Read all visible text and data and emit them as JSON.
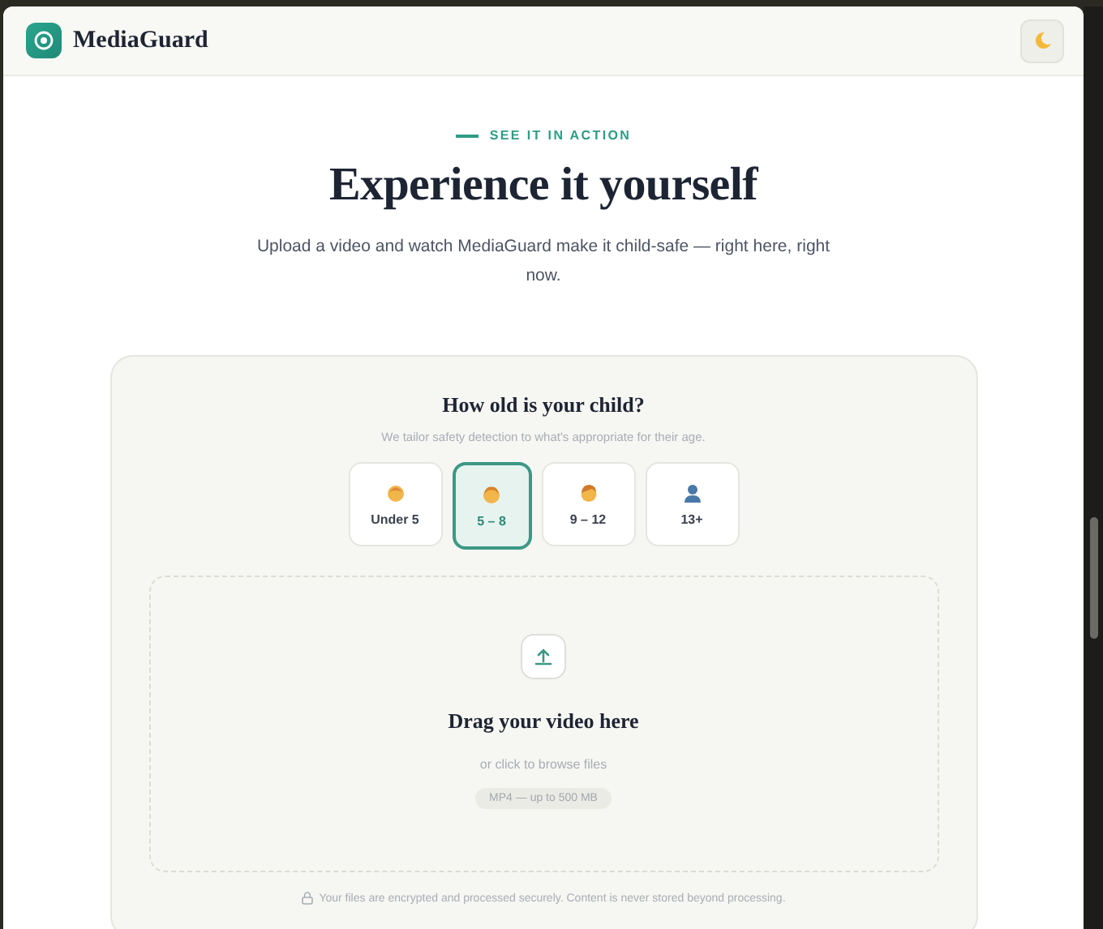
{
  "header": {
    "brand": "MediaGuard"
  },
  "hero": {
    "eyebrow": "SEE IT IN ACTION",
    "title": "Experience it yourself",
    "subtitle": "Upload a video and watch MediaGuard make it child-safe — right here, right now."
  },
  "age_picker": {
    "title": "How old is your child?",
    "subtitle": "We tailor safety detection to what's appropriate for their age.",
    "options": [
      {
        "label": "Under 5",
        "kind": "baby",
        "selected": false
      },
      {
        "label": "5 – 8",
        "kind": "child",
        "selected": true
      },
      {
        "label": "9 – 12",
        "kind": "boy",
        "selected": false
      },
      {
        "label": "13+",
        "kind": "person",
        "selected": false
      }
    ]
  },
  "upload": {
    "title": "Drag your video here",
    "hint": "or click to browse files",
    "badge": "MP4 — up to 500 MB"
  },
  "security_note": "Your files are encrypted and processed securely. Content is never stored beyond processing."
}
